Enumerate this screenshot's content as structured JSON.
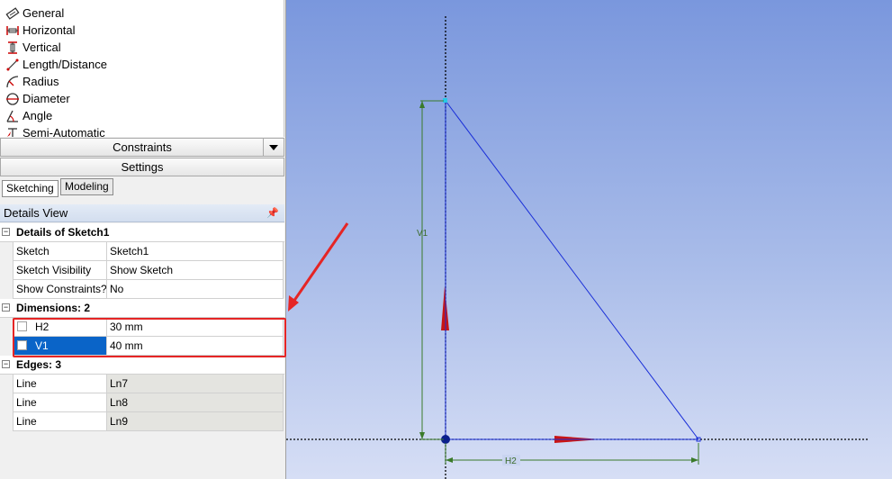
{
  "toolbox": {
    "items": [
      {
        "label": "General",
        "icon": "general-dimension-icon"
      },
      {
        "label": "Horizontal",
        "icon": "horizontal-dimension-icon"
      },
      {
        "label": "Vertical",
        "icon": "vertical-dimension-icon"
      },
      {
        "label": "Length/Distance",
        "icon": "length-distance-icon"
      },
      {
        "label": "Radius",
        "icon": "radius-icon"
      },
      {
        "label": "Diameter",
        "icon": "diameter-icon"
      },
      {
        "label": "Angle",
        "icon": "angle-icon"
      },
      {
        "label": "Semi-Automatic",
        "icon": "semi-automatic-icon"
      }
    ],
    "constraints_label": "Constraints",
    "settings_label": "Settings"
  },
  "tabs": {
    "sketching": "Sketching",
    "modeling": "Modeling"
  },
  "details": {
    "title": "Details View",
    "pin_icon": "pin-icon",
    "sections": {
      "sketch": {
        "label": "Details of Sketch1",
        "rows": [
          {
            "key": "Sketch",
            "value": "Sketch1"
          },
          {
            "key": "Sketch Visibility",
            "value": "Show Sketch"
          },
          {
            "key": "Show Constraints?",
            "value": "No"
          }
        ]
      },
      "dimensions": {
        "label": "Dimensions: 2",
        "rows": [
          {
            "key": "H2",
            "value": "30 mm"
          },
          {
            "key": "V1",
            "value": "40 mm"
          }
        ]
      },
      "edges": {
        "label": "Edges: 3",
        "rows": [
          {
            "key": "Line",
            "value": "Ln7"
          },
          {
            "key": "Line",
            "value": "Ln8"
          },
          {
            "key": "Line",
            "value": "Ln9"
          }
        ]
      }
    }
  },
  "viewport": {
    "dim_v_label": "V1",
    "dim_h_label": "H2",
    "colors": {
      "sketch_line": "#1a2fd8",
      "dimension": "#3a7a2a",
      "axis": "#000000",
      "axis_arrow": "#d01010",
      "highlight": "#e52525",
      "selection": "#0a64c8"
    }
  }
}
